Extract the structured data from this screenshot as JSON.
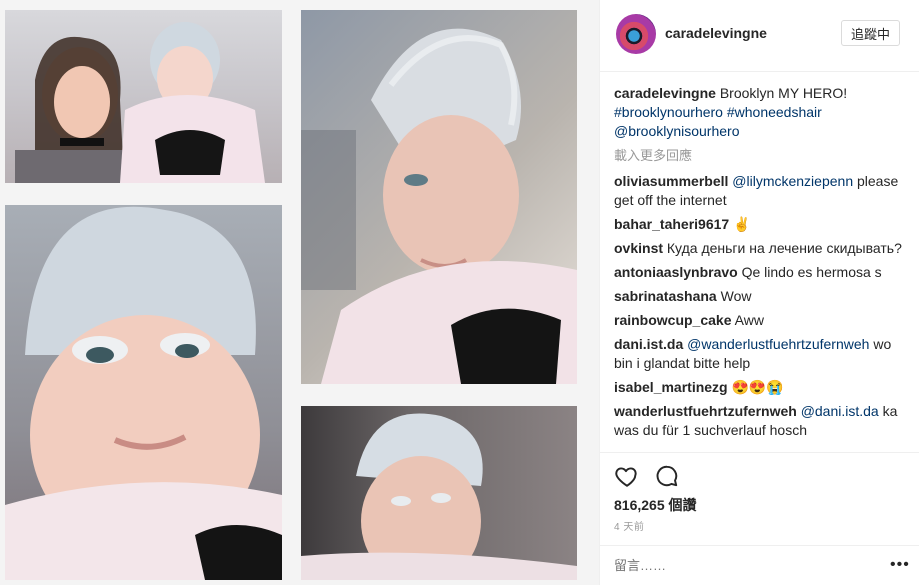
{
  "header": {
    "username": "caradelevingne",
    "follow_label": "追蹤中"
  },
  "caption": {
    "user": "caradelevingne",
    "text": "Brooklyn MY HERO!",
    "tags": [
      "#brooklynourhero",
      "#whoneedshair",
      "@brooklynisourhero"
    ]
  },
  "load_more": "載入更多回應",
  "comments": [
    {
      "user": "oliviasummerbell",
      "mention": "@lilymckenziepenn",
      "text": "please get off the internet"
    },
    {
      "user": "bahar_taheri9617",
      "mention": "",
      "text": "✌️"
    },
    {
      "user": "ovkinst",
      "mention": "",
      "text": "Куда деньги на лечение скидывать?"
    },
    {
      "user": "antoniaaslynbravo",
      "mention": "",
      "text": "Qe lindo es hermosa s"
    },
    {
      "user": "sabrinatashana",
      "mention": "",
      "text": "Wow"
    },
    {
      "user": "rainbowcup_cake",
      "mention": "",
      "text": "Aww"
    },
    {
      "user": "dani.ist.da",
      "mention": "@wanderlustfuehrtzufernweh",
      "text": "wo bin i glandat bitte help"
    },
    {
      "user": "isabel_martinezg",
      "mention": "",
      "text": "😍😍😭"
    },
    {
      "user": "wanderlustfuehrtzufernweh",
      "mention": "@dani.ist.da",
      "text": "ka was du für 1 suchverlauf hosch"
    }
  ],
  "actions": {
    "likes": "816,265 個讚",
    "time_ago": "4 天前",
    "comment_placeholder": "留言……",
    "more": "•••"
  },
  "icons": {
    "like": "heart-outline-icon",
    "comment": "speech-bubble-icon"
  }
}
